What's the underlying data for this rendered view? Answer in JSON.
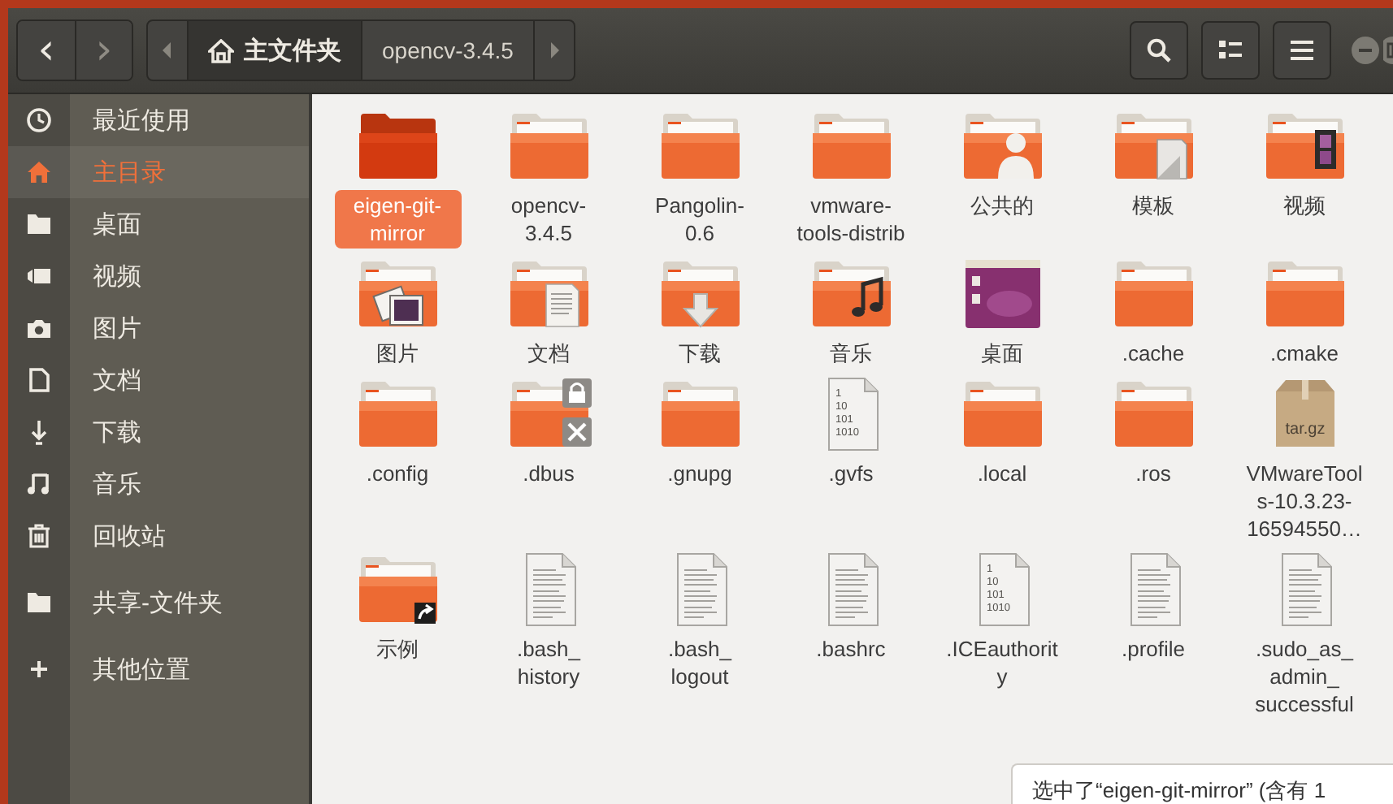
{
  "toolbar": {
    "back": "‹",
    "forward": "›",
    "path": [
      {
        "label": "主文件夹",
        "kind": "home",
        "selected": true
      },
      {
        "label": "opencv-3.4.5",
        "kind": "folder",
        "selected": false
      }
    ]
  },
  "sidebar": {
    "sections": [
      {
        "items": [
          {
            "label": "最近使用",
            "kind": "recent",
            "selected": false
          },
          {
            "label": "主目录",
            "kind": "home",
            "selected": true
          },
          {
            "label": "桌面",
            "kind": "folder",
            "selected": false
          },
          {
            "label": "视频",
            "kind": "video",
            "selected": false
          },
          {
            "label": "图片",
            "kind": "camera",
            "selected": false
          },
          {
            "label": "文档",
            "kind": "document",
            "selected": false
          },
          {
            "label": "下载",
            "kind": "download",
            "selected": false
          },
          {
            "label": "音乐",
            "kind": "music",
            "selected": false
          },
          {
            "label": "回收站",
            "kind": "trash",
            "selected": false
          }
        ]
      },
      {
        "items": [
          {
            "label": "共享-文件夹",
            "kind": "folder",
            "selected": false
          }
        ]
      },
      {
        "items": [
          {
            "label": "其他位置",
            "kind": "add",
            "selected": false
          }
        ]
      }
    ]
  },
  "files": [
    {
      "name": "eigen-git-mirror",
      "kind": "folder",
      "selected": true
    },
    {
      "name": "opencv-3.4.5",
      "kind": "folder",
      "selected": false
    },
    {
      "name": "Pangolin-0.6",
      "kind": "folder",
      "selected": false
    },
    {
      "name": "vmware-tools-distrib",
      "kind": "folder",
      "selected": false
    },
    {
      "name": "公共的",
      "kind": "user-folder",
      "selected": false
    },
    {
      "name": "模板",
      "kind": "template-folder",
      "selected": false
    },
    {
      "name": "视频",
      "kind": "video-folder",
      "selected": false
    },
    {
      "name": "图片",
      "kind": "pictures-folder",
      "selected": false
    },
    {
      "name": "文档",
      "kind": "documents-folder",
      "selected": false
    },
    {
      "name": "下载",
      "kind": "download-folder",
      "selected": false
    },
    {
      "name": "音乐",
      "kind": "music-folder",
      "selected": false
    },
    {
      "name": "桌面",
      "kind": "desktop-folder",
      "selected": false
    },
    {
      "name": ".cache",
      "kind": "folder",
      "selected": false
    },
    {
      "name": ".cmake",
      "kind": "folder",
      "selected": false
    },
    {
      "name": ".config",
      "kind": "folder",
      "selected": false
    },
    {
      "name": ".dbus",
      "kind": "locked-folder",
      "selected": false
    },
    {
      "name": ".gnupg",
      "kind": "folder",
      "selected": false
    },
    {
      "name": ".gvfs",
      "kind": "binary-file",
      "selected": false,
      "icon_text": [
        "1",
        "10",
        "101",
        "1010"
      ]
    },
    {
      "name": ".local",
      "kind": "folder",
      "selected": false
    },
    {
      "name": ".ros",
      "kind": "folder",
      "selected": false
    },
    {
      "name": "VMwareTools-10.3.23-16594550…",
      "kind": "archive",
      "selected": false,
      "icon_text": [
        "tar.gz"
      ]
    },
    {
      "name": "示例",
      "kind": "link-folder",
      "selected": false
    },
    {
      "name": ".bash_history",
      "kind": "text-file",
      "selected": false
    },
    {
      "name": ".bash_logout",
      "kind": "text-file",
      "selected": false
    },
    {
      "name": ".bashrc",
      "kind": "text-file",
      "selected": false
    },
    {
      "name": ".ICEauthority",
      "kind": "binary-file",
      "selected": false,
      "icon_text": [
        "1",
        "10",
        "101",
        "1010"
      ]
    },
    {
      "name": ".profile",
      "kind": "text-file",
      "selected": false
    },
    {
      "name": ".sudo_as_admin_successful",
      "kind": "text-file",
      "selected": false
    }
  ],
  "status": "选中了“eigen-git-mirror” (含有 1"
}
